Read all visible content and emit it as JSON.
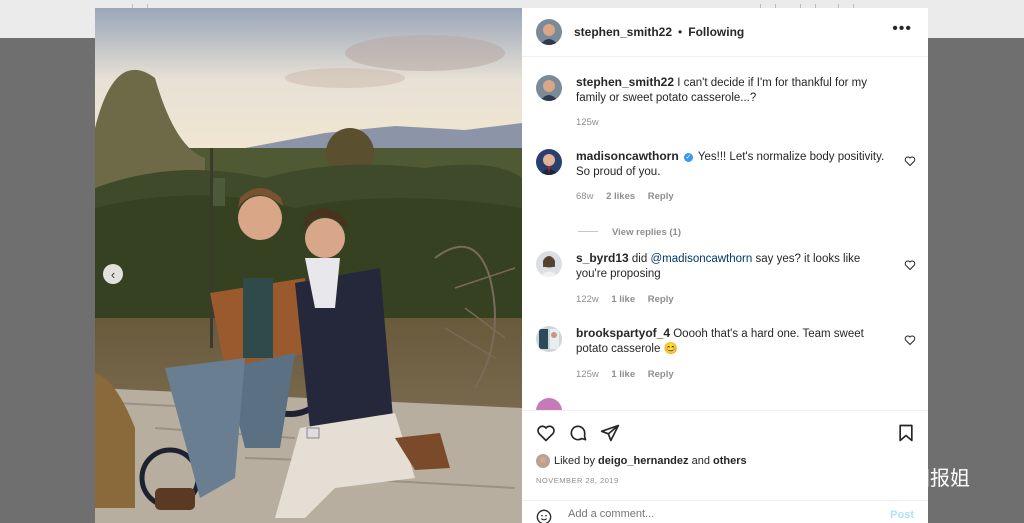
{
  "header": {
    "username": "stephen_smith22",
    "separator": "•",
    "follow_state": "Following",
    "more_label": "•••"
  },
  "caption": {
    "username": "stephen_smith22",
    "text": "I can't decide if I'm for thankful for my family or sweet potato casserole...?",
    "age": "125w"
  },
  "comments": [
    {
      "username": "madisoncawthorn",
      "verified": true,
      "text": "Yes!!! Let's normalize body positivity. So proud of you.",
      "age": "68w",
      "likes": "2 likes",
      "reply_label": "Reply",
      "view_replies": "View replies (1)"
    },
    {
      "username": "s_byrd13",
      "text_before": "did",
      "mention": "@madisoncawthorn",
      "text_after": "say yes? it looks like you're proposing",
      "age": "122w",
      "likes": "1 like",
      "reply_label": "Reply"
    },
    {
      "username": "brookspartyof_4",
      "text": "Ooooh that's a hard one. Team sweet potato casserole 😊",
      "age": "125w",
      "likes": "1 like",
      "reply_label": "Reply"
    }
  ],
  "likes_line": {
    "prefix": "Liked by",
    "user": "deigo_hernandez",
    "joiner": "and",
    "others": "others"
  },
  "post_date": "NOVEMBER 28, 2019",
  "add_comment": {
    "placeholder": "Add a comment...",
    "post_label": "Post"
  },
  "carousel_prev": "‹",
  "watermark": "英国报姐",
  "colors": {
    "accent_blue": "#3897f0",
    "mention": "#00376b",
    "muted": "#8e8e8e"
  },
  "icons": [
    "heart-icon",
    "comment-icon",
    "share-icon",
    "bookmark-icon",
    "smile-icon",
    "verified-icon",
    "more-icon",
    "chevron-left-icon"
  ]
}
